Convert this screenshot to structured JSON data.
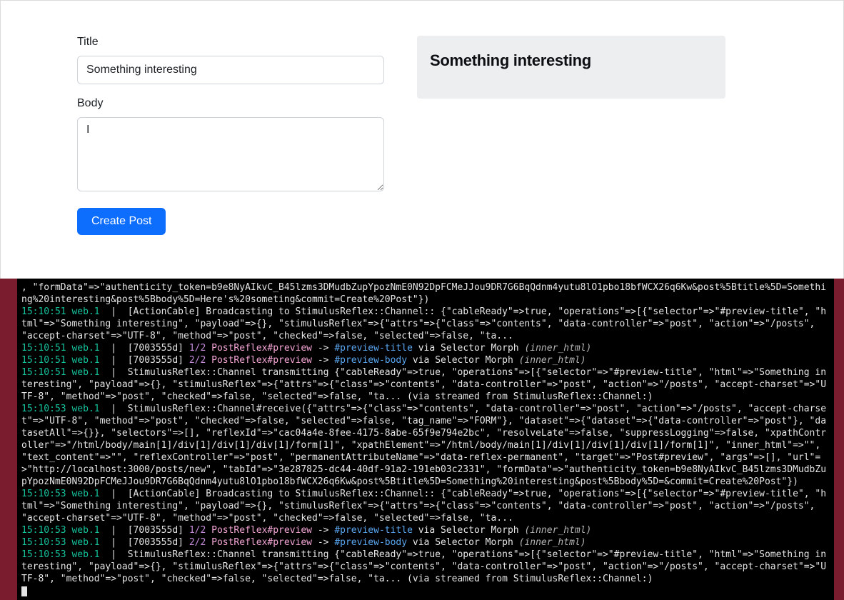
{
  "form": {
    "title_label": "Title",
    "title_value": "Something interesting",
    "body_label": "Body",
    "body_value": "I",
    "submit_label": "Create Post"
  },
  "preview": {
    "title": "Something interesting"
  },
  "terminal": {
    "lines": [
      {
        "raw": ", \"formData\"=>\"authenticity_token=b9e8NyAIkvC_B45lzms3DMudbZupYpozNmE0N92DpFCMeJJou9DR7G6BqQdnm4yutu8lO1pbo18bfWCX26q6Kw&post%5Btitle%5D=Something%20interesting&post%5Bbody%5D=Here's%20someting&commit=Create%20Post\"})"
      },
      {
        "ts": "15:10:51",
        "proc": "web.1",
        "rest": "[ActionCable] Broadcasting to StimulusReflex::Channel:: {\"cableReady\"=>true, \"operations\"=>[{\"selector\"=>\"#preview-title\", \"html\"=>\"Something interesting\", \"payload\"=>{}, \"stimulusReflex\"=>{\"attrs\"=>{\"class\"=>\"contents\", \"data-controller\"=>\"post\", \"action\"=>\"/posts\", \"accept-charset\"=>\"UTF-8\", \"method\"=>\"post\", \"checked\"=>false, \"selected\"=>false, \"ta..."
      },
      {
        "ts": "15:10:51",
        "proc": "web.1",
        "pid": "[7003555d]",
        "frac": "1/2",
        "reflex": "PostReflex#preview",
        "arrow": "->",
        "sel": "#preview-title",
        "morph": "via Selector Morph",
        "inner": "(inner_html)"
      },
      {
        "ts": "15:10:51",
        "proc": "web.1",
        "pid": "[7003555d]",
        "frac": "2/2",
        "reflex": "PostReflex#preview",
        "arrow": "->",
        "sel": "#preview-body",
        "morph": "via Selector Morph",
        "inner": "(inner_html)"
      },
      {
        "ts": "15:10:51",
        "proc": "web.1",
        "rest": "StimulusReflex::Channel transmitting {\"cableReady\"=>true, \"operations\"=>[{\"selector\"=>\"#preview-title\", \"html\"=>\"Something interesting\", \"payload\"=>{}, \"stimulusReflex\"=>{\"attrs\"=>{\"class\"=>\"contents\", \"data-controller\"=>\"post\", \"action\"=>\"/posts\", \"accept-charset\"=>\"UTF-8\", \"method\"=>\"post\", \"checked\"=>false, \"selected\"=>false, \"ta... (via streamed from StimulusReflex::Channel:)"
      },
      {
        "ts": "15:10:53",
        "proc": "web.1",
        "rest": "StimulusReflex::Channel#receive({\"attrs\"=>{\"class\"=>\"contents\", \"data-controller\"=>\"post\", \"action\"=>\"/posts\", \"accept-charset\"=>\"UTF-8\", \"method\"=>\"post\", \"checked\"=>false, \"selected\"=>false, \"tag_name\"=>\"FORM\"}, \"dataset\"=>{\"dataset\"=>{\"data-controller\"=>\"post\"}, \"datasetAll\"=>{}}, \"selectors\"=>[], \"reflexId\"=>\"cac04a4e-8fee-4175-8abe-65f9e794e2bc\", \"resolveLate\"=>false, \"suppressLogging\"=>false, \"xpathController\"=>\"/html/body/main[1]/div[1]/div[1]/div[1]/form[1]\", \"xpathElement\"=>\"/html/body/main[1]/div[1]/div[1]/div[1]/form[1]\", \"inner_html\"=>\"\", \"text_content\"=>\"\", \"reflexController\"=>\"post\", \"permanentAttributeName\"=>\"data-reflex-permanent\", \"target\"=>\"Post#preview\", \"args\"=>[], \"url\"=>\"http://localhost:3000/posts/new\", \"tabId\"=>\"3e287825-dc44-40df-91a2-191eb03c2331\", \"formData\"=>\"authenticity_token=b9e8NyAIkvC_B45lzms3DMudbZupYpozNmE0N92DpFCMeJJou9DR7G6BqQdnm4yutu8lO1pbo18bfWCX26q6Kw&post%5Btitle%5D=Something%20interesting&post%5Bbody%5D=&commit=Create%20Post\"})"
      },
      {
        "ts": "15:10:53",
        "proc": "web.1",
        "rest": "[ActionCable] Broadcasting to StimulusReflex::Channel:: {\"cableReady\"=>true, \"operations\"=>[{\"selector\"=>\"#preview-title\", \"html\"=>\"Something interesting\", \"payload\"=>{}, \"stimulusReflex\"=>{\"attrs\"=>{\"class\"=>\"contents\", \"data-controller\"=>\"post\", \"action\"=>\"/posts\", \"accept-charset\"=>\"UTF-8\", \"method\"=>\"post\", \"checked\"=>false, \"selected\"=>false, \"ta..."
      },
      {
        "ts": "15:10:53",
        "proc": "web.1",
        "pid": "[7003555d]",
        "frac": "1/2",
        "reflex": "PostReflex#preview",
        "arrow": "->",
        "sel": "#preview-title",
        "morph": "via Selector Morph",
        "inner": "(inner_html)"
      },
      {
        "ts": "15:10:53",
        "proc": "web.1",
        "pid": "[7003555d]",
        "frac": "2/2",
        "reflex": "PostReflex#preview",
        "arrow": "->",
        "sel": "#preview-body",
        "morph": "via Selector Morph",
        "inner": "(inner_html)"
      },
      {
        "ts": "15:10:53",
        "proc": "web.1",
        "rest": "StimulusReflex::Channel transmitting {\"cableReady\"=>true, \"operations\"=>[{\"selector\"=>\"#preview-title\", \"html\"=>\"Something interesting\", \"payload\"=>{}, \"stimulusReflex\"=>{\"attrs\"=>{\"class\"=>\"contents\", \"data-controller\"=>\"post\", \"action\"=>\"/posts\", \"accept-charset\"=>\"UTF-8\", \"method\"=>\"post\", \"checked\"=>false, \"selected\"=>false, \"ta... (via streamed from StimulusReflex::Channel:)"
      }
    ]
  },
  "colors": {
    "accent": "#0d6efd",
    "terminal_bg": "#000",
    "ts": "#15c19b",
    "frac": "#c38bd8",
    "reflex": "#f5a6d6",
    "sel": "#5aa8f2"
  }
}
